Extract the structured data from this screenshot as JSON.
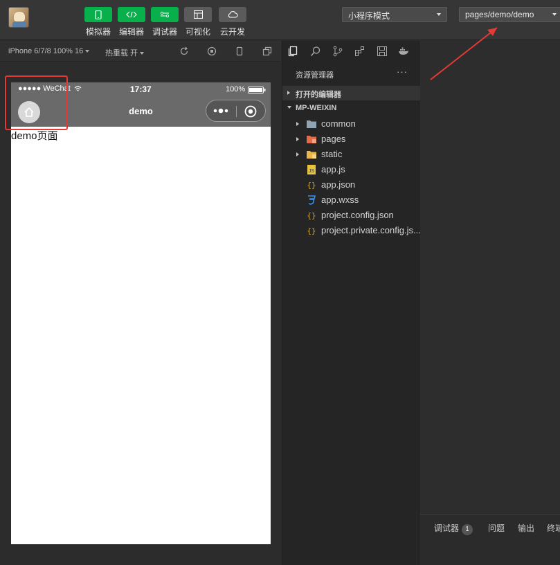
{
  "toolbar": {
    "tools": [
      {
        "label": "模拟器",
        "icon": "phone-icon",
        "style": "green"
      },
      {
        "label": "编辑器",
        "icon": "code-icon",
        "style": "green"
      },
      {
        "label": "调试器",
        "icon": "debugger-icon",
        "style": "green"
      },
      {
        "label": "可视化",
        "icon": "layout-icon",
        "style": "gray"
      },
      {
        "label": "云开发",
        "icon": "cloud-icon",
        "style": "gray"
      }
    ],
    "mode_select": "小程序模式",
    "page_select": "pages/demo/demo"
  },
  "simulator": {
    "device": "iPhone 6/7/8 100% 16",
    "hot_reload": "热重载 开",
    "status": {
      "carrier": "●●●●● WeChat",
      "time": "17:37",
      "battery": "100%"
    },
    "nav_title": "demo",
    "page_content": "demo页面"
  },
  "explorer": {
    "title": "资源管理器",
    "more": "···",
    "open_editors": "打开的编辑器",
    "root": "MP-WEIXIN",
    "items": [
      {
        "name": "common",
        "type": "folder",
        "icon": "folder-icon",
        "color": "#8fa3b3"
      },
      {
        "name": "pages",
        "type": "folder",
        "icon": "folder-pages-icon",
        "color": "#e06c4b"
      },
      {
        "name": "static",
        "type": "folder",
        "icon": "folder-static-icon",
        "color": "#e8b54a"
      },
      {
        "name": "app.js",
        "type": "file",
        "icon": "js-file-icon",
        "color": "#e8c43b"
      },
      {
        "name": "app.json",
        "type": "file",
        "icon": "json-file-icon",
        "color": "#d4a937"
      },
      {
        "name": "app.wxss",
        "type": "file",
        "icon": "css-file-icon",
        "color": "#3f8fe0"
      },
      {
        "name": "project.config.json",
        "type": "file",
        "icon": "json-file-icon",
        "color": "#d4a937"
      },
      {
        "name": "project.private.config.js...",
        "type": "file",
        "icon": "json-file-icon",
        "color": "#d4a937"
      }
    ]
  },
  "debug": {
    "tabs": [
      {
        "label": "调试器",
        "badge": "1"
      },
      {
        "label": "问题"
      },
      {
        "label": "输出"
      },
      {
        "label": "终端"
      }
    ]
  },
  "colors": {
    "accent_green": "#07b04b",
    "annotation_red": "#e53935"
  }
}
